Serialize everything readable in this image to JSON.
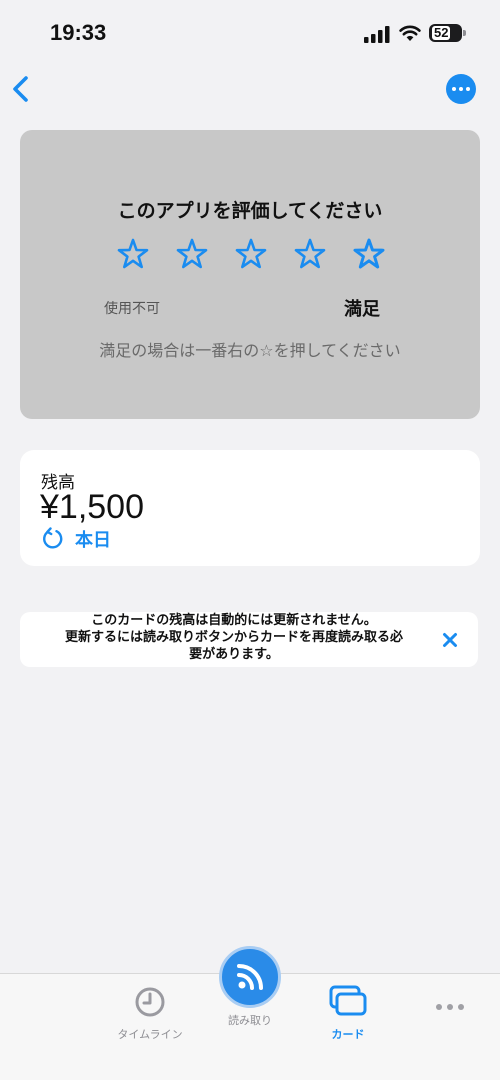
{
  "status_bar": {
    "time": "19:33",
    "battery": "52"
  },
  "nav": {
    "back_icon": "chevron-left-icon",
    "more_icon": "ellipsis-circle-icon"
  },
  "rating": {
    "title": "このアプリを評価してください",
    "stars_total": 5,
    "label_left": "使用不可",
    "label_right": "満足",
    "hint": "満足の場合は一番右の☆を押してください"
  },
  "balance": {
    "label": "残高",
    "value": "¥1,500",
    "refresh_label": "本日"
  },
  "notice": {
    "line1": "このカードの残高は自動的には更新されません。",
    "line2": "更新するには読み取りボタンからカードを再度読み取る必",
    "line3": "要があります。"
  },
  "tab_bar": {
    "timeline": "タイムライン",
    "scan": "読み取り",
    "card": "カード",
    "active": "card"
  },
  "colors": {
    "accent": "#1a8cf0",
    "rating_card_bg": "#c8c8c8",
    "page_bg": "#f2f2f4"
  }
}
